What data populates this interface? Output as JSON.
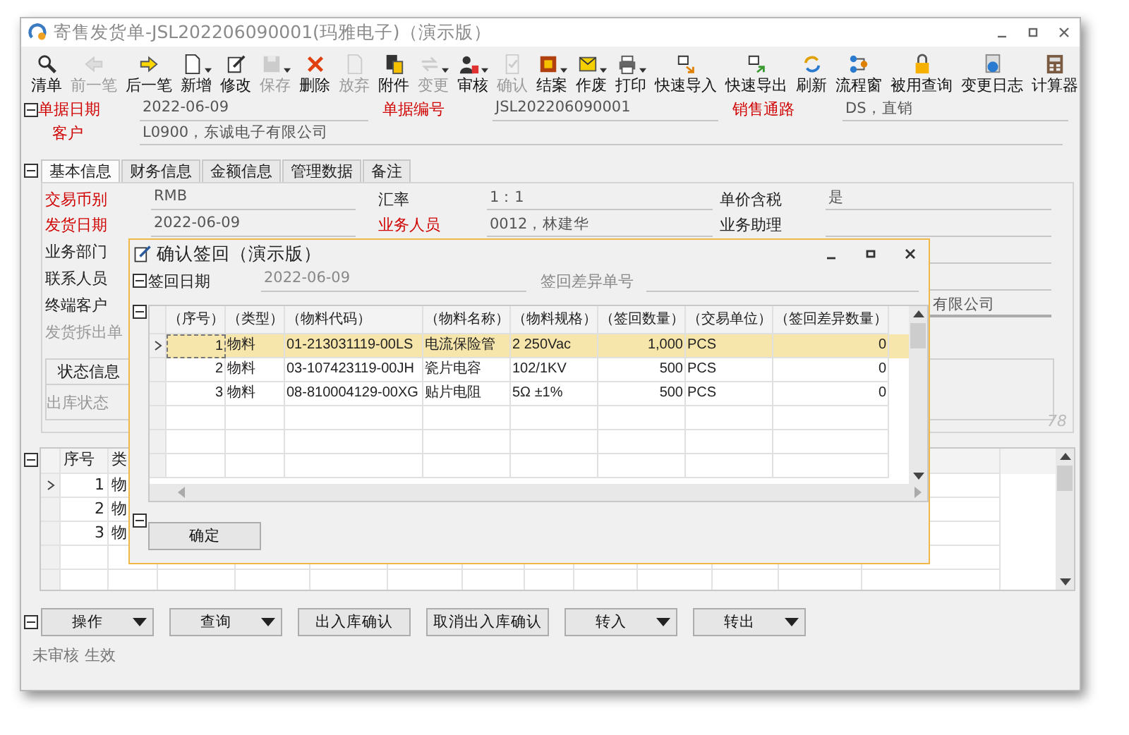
{
  "window": {
    "title": "寄售发货单-JSL202206090001(玛雅电子)（演示版）"
  },
  "toolbar": [
    {
      "label": "清单",
      "disabled": false,
      "dropdown": false
    },
    {
      "label": "前一笔",
      "disabled": true,
      "dropdown": false
    },
    {
      "label": "后一笔",
      "disabled": false,
      "dropdown": false
    },
    {
      "label": "新增",
      "disabled": false,
      "dropdown": true
    },
    {
      "label": "修改",
      "disabled": false,
      "dropdown": false
    },
    {
      "label": "保存",
      "disabled": true,
      "dropdown": true
    },
    {
      "label": "删除",
      "disabled": false,
      "dropdown": false
    },
    {
      "label": "放弃",
      "disabled": true,
      "dropdown": false
    },
    {
      "label": "附件",
      "disabled": false,
      "dropdown": false
    },
    {
      "label": "变更",
      "disabled": true,
      "dropdown": true
    },
    {
      "label": "审核",
      "disabled": false,
      "dropdown": true
    },
    {
      "label": "确认",
      "disabled": true,
      "dropdown": false
    },
    {
      "label": "结案",
      "disabled": false,
      "dropdown": true
    },
    {
      "label": "作废",
      "disabled": false,
      "dropdown": true
    },
    {
      "label": "打印",
      "disabled": false,
      "dropdown": true
    },
    {
      "label": "快速导入",
      "disabled": false,
      "dropdown": false
    },
    {
      "label": "快速导出",
      "disabled": false,
      "dropdown": false
    },
    {
      "label": "刷新",
      "disabled": false,
      "dropdown": false
    },
    {
      "label": "流程窗",
      "disabled": false,
      "dropdown": false
    },
    {
      "label": "被用查询",
      "disabled": false,
      "dropdown": false
    },
    {
      "label": "变更日志",
      "disabled": false,
      "dropdown": false
    },
    {
      "label": "计算器",
      "disabled": false,
      "dropdown": false
    }
  ],
  "header": {
    "rows": [
      {
        "fields": [
          {
            "label": "单据日期",
            "required": true,
            "value": "2022-06-09"
          },
          {
            "label": "单据编号",
            "required": true,
            "value": "JSL202206090001"
          },
          {
            "label": "销售通路",
            "required": true,
            "value": "DS，直销"
          }
        ]
      },
      {
        "fields": [
          {
            "label": "客户",
            "required": true,
            "value": "L0900，东诚电子有限公司"
          }
        ]
      }
    ]
  },
  "tabs": [
    {
      "label": "基本信息",
      "selected": true
    },
    {
      "label": "财务信息",
      "selected": false
    },
    {
      "label": "金额信息",
      "selected": false
    },
    {
      "label": "管理数据",
      "selected": false
    },
    {
      "label": "备注",
      "selected": false
    }
  ],
  "basic_info": {
    "rows": [
      {
        "cells": [
          {
            "label": "交易币别",
            "required": true,
            "value": "RMB"
          },
          {
            "label": "汇率",
            "required": false,
            "value": "1：1"
          },
          {
            "label": "单价含税",
            "required": false,
            "value": "是"
          }
        ]
      },
      {
        "cells": [
          {
            "label": "发货日期",
            "required": true,
            "value": "2022-06-09"
          },
          {
            "label": "业务人员",
            "required": true,
            "value": "0012，林建华"
          },
          {
            "label": "业务助理",
            "required": false
          }
        ]
      },
      {
        "cells": [
          {
            "label": "业务部门",
            "required": false
          }
        ]
      },
      {
        "cells": [
          {
            "label": "联系人员",
            "required": false
          }
        ]
      },
      {
        "cells": [
          {
            "label": "终端客户",
            "required": false
          }
        ],
        "tail": "有限公司"
      },
      {
        "cells": [
          {
            "label": "发货拆出单",
            "disabled": true
          }
        ]
      }
    ],
    "status": {
      "title": "状态信息",
      "items": [
        "出库状态"
      ]
    },
    "corner_mark": "78"
  },
  "detail_grid": {
    "columns": [
      "序号",
      "类"
    ],
    "rows": [
      {
        "cells": [
          "1",
          "物"
        ],
        "current": true
      },
      {
        "cells": [
          "2",
          "物"
        ],
        "current": false
      },
      {
        "cells": [
          "3",
          "物"
        ],
        "current": false
      }
    ]
  },
  "buttons": [
    {
      "label": "操作",
      "dropdown": true
    },
    {
      "label": "查询",
      "dropdown": true
    },
    {
      "label": "出入库确认",
      "dropdown": false
    },
    {
      "label": "取消出入库确认",
      "dropdown": false
    },
    {
      "label": "转入",
      "dropdown": true
    },
    {
      "label": "转出",
      "dropdown": true
    }
  ],
  "status_bar": [
    "未审核",
    "生效"
  ],
  "dialog": {
    "title": "确认签回（演示版）",
    "fields": [
      {
        "label": "签回日期",
        "disabled": false,
        "value": "2022-06-09"
      },
      {
        "label": "签回差异单号",
        "disabled": true
      }
    ],
    "columns": [
      {
        "label": "（序号）",
        "numeric": true
      },
      {
        "label": "（类型）",
        "numeric": false
      },
      {
        "label": "（物料代码）",
        "numeric": false
      },
      {
        "label": "（物料名称）",
        "numeric": false
      },
      {
        "label": "（物料规格）",
        "numeric": false
      },
      {
        "label": "（签回数量）",
        "numeric": true
      },
      {
        "label": "（交易单位）",
        "numeric": false
      },
      {
        "label": "（签回差异数量）",
        "numeric": true
      }
    ],
    "rows": [
      {
        "cells": [
          "1",
          "物料",
          "01-213031119-00LS",
          "电流保险管",
          "2 250Vac",
          "1,000",
          "PCS",
          "0"
        ],
        "selected": true
      },
      {
        "cells": [
          "2",
          "物料",
          "03-107423119-00JH",
          "瓷片电容",
          "102/1KV",
          "500",
          "PCS",
          "0"
        ],
        "selected": false
      },
      {
        "cells": [
          "3",
          "物料",
          "08-810004129-00XG",
          "贴片电阻",
          "5Ω ±1%",
          "500",
          "PCS",
          "0"
        ],
        "selected": false
      }
    ],
    "button": "确定"
  }
}
